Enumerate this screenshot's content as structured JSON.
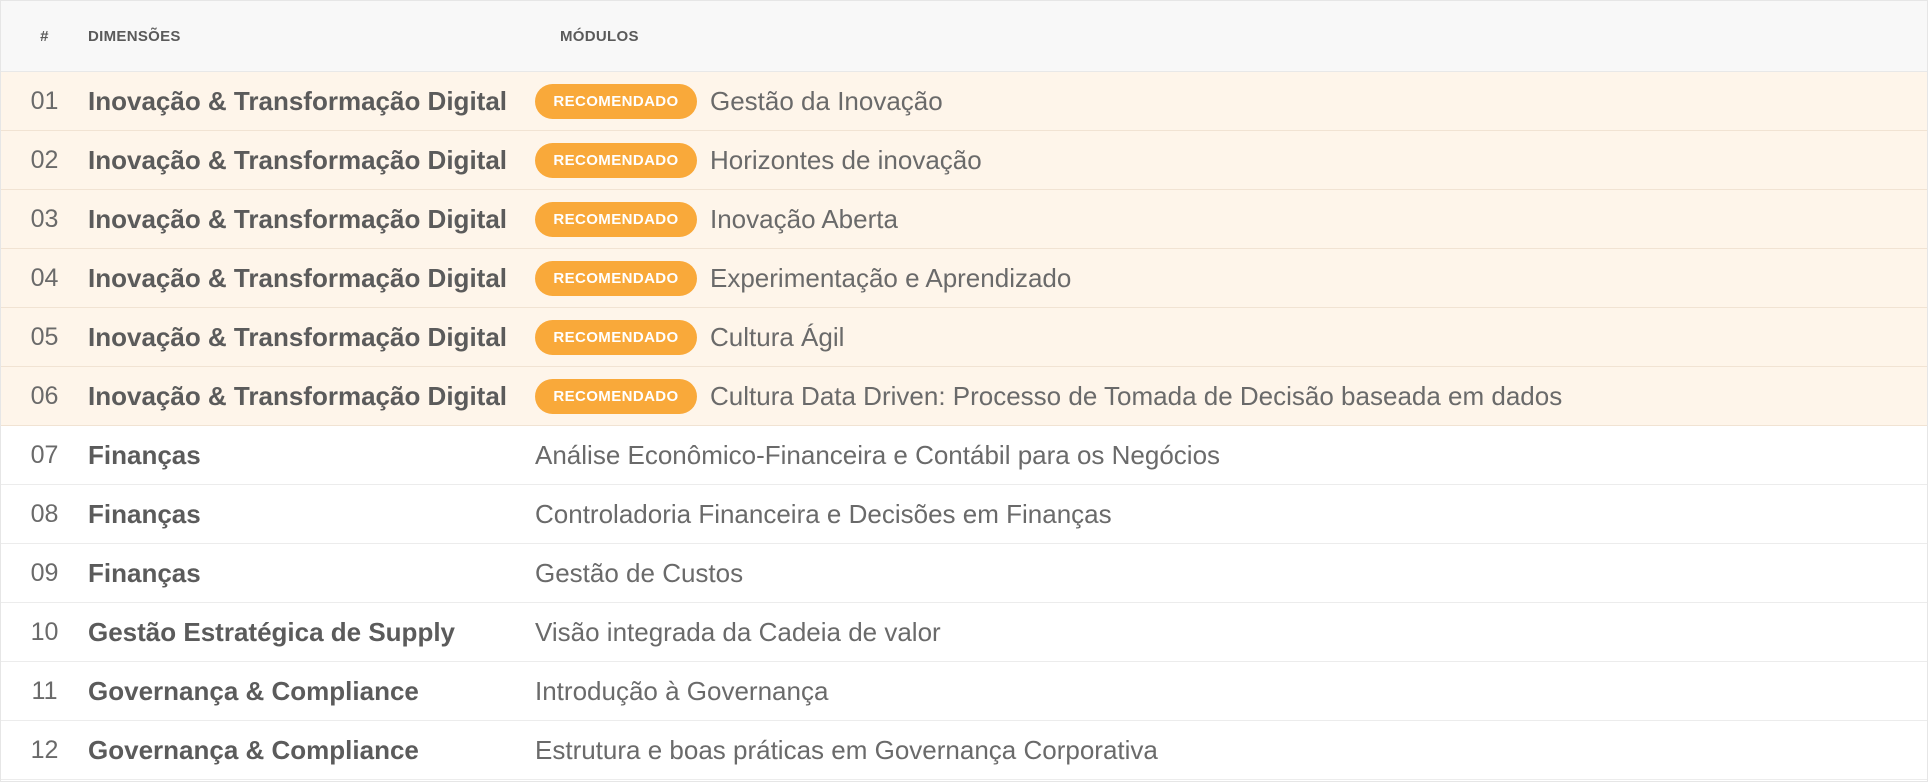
{
  "header": {
    "num": "#",
    "dimensions": "DIMENSÕES",
    "modules": "MÓDULOS"
  },
  "colors": {
    "accent": "#f9a93a",
    "recommended_row_bg": "#fef5ea"
  },
  "badge_label": "RECOMENDADO",
  "rows": [
    {
      "num": "01",
      "dimension": "Inovação & Transformação Digital",
      "module": "Gestão da Inovação",
      "recommended": true
    },
    {
      "num": "02",
      "dimension": "Inovação & Transformação Digital",
      "module": "Horizontes de inovação",
      "recommended": true
    },
    {
      "num": "03",
      "dimension": "Inovação & Transformação Digital",
      "module": "Inovação Aberta",
      "recommended": true
    },
    {
      "num": "04",
      "dimension": "Inovação & Transformação Digital",
      "module": "Experimentação e Aprendizado",
      "recommended": true
    },
    {
      "num": "05",
      "dimension": "Inovação & Transformação Digital",
      "module": "Cultura Ágil",
      "recommended": true
    },
    {
      "num": "06",
      "dimension": "Inovação & Transformação Digital",
      "module": "Cultura Data Driven: Processo de Tomada de Decisão baseada em dados",
      "recommended": true
    },
    {
      "num": "07",
      "dimension": "Finanças",
      "module": "Análise Econômico-Financeira e Contábil para os Negócios",
      "recommended": false
    },
    {
      "num": "08",
      "dimension": "Finanças",
      "module": "Controladoria Financeira e Decisões em Finanças",
      "recommended": false
    },
    {
      "num": "09",
      "dimension": "Finanças",
      "module": "Gestão de Custos",
      "recommended": false
    },
    {
      "num": "10",
      "dimension": "Gestão Estratégica de Supply",
      "module": "Visão integrada da Cadeia de valor",
      "recommended": false
    },
    {
      "num": "11",
      "dimension": "Governança & Compliance",
      "module": "Introdução à Governança",
      "recommended": false
    },
    {
      "num": "12",
      "dimension": "Governança & Compliance",
      "module": "Estrutura e boas práticas em Governança Corporativa",
      "recommended": false
    }
  ]
}
